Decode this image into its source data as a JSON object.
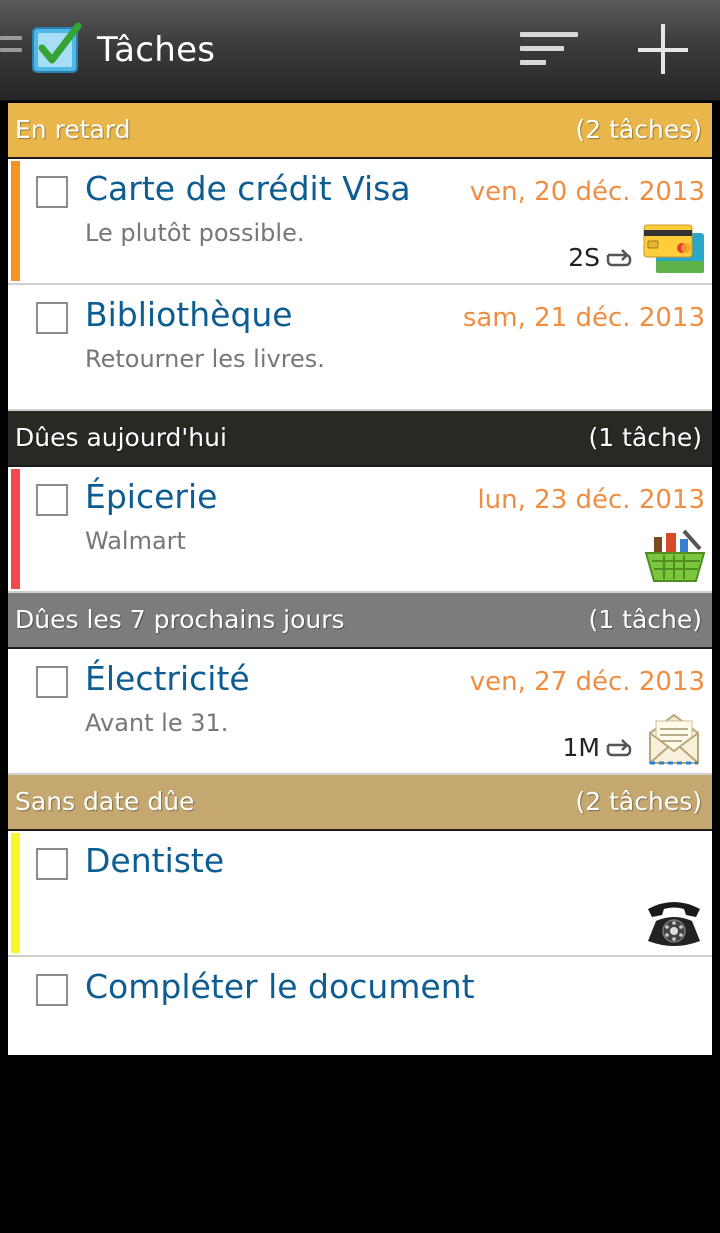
{
  "app": {
    "title": "Tâches"
  },
  "sections": [
    {
      "label": "En retard",
      "count": "(2 tâches)",
      "color": "#e8b64a",
      "tasks": [
        {
          "name": "Carte de crédit Visa",
          "date": "ven, 20 déc. 2013",
          "note": "Le plutôt possible.",
          "recurrence": "2S",
          "priority_color": "#f7931e",
          "icon": "credit-card-icon"
        },
        {
          "name": "Bibliothèque",
          "date": "sam, 21 déc. 2013",
          "note": "Retourner les livres."
        }
      ]
    },
    {
      "label": "Dûes aujourd'hui",
      "count": "(1 tâche)",
      "color": "#262a23",
      "tasks": [
        {
          "name": "Épicerie",
          "date": "lun, 23 déc. 2013",
          "note": "Walmart",
          "priority_color": "#f1494d",
          "icon": "grocery-basket-icon"
        }
      ]
    },
    {
      "label": "Dûes les 7 prochains jours",
      "count": "(1 tâche)",
      "color": "#7b7d7a",
      "tasks": [
        {
          "name": "Électricité",
          "date": "ven, 27 déc. 2013",
          "note": "Avant le 31.",
          "recurrence": "1M",
          "icon": "envelope-icon"
        }
      ]
    },
    {
      "label": "Sans date dûe",
      "count": "(2 tâches)",
      "color": "#c4a86f",
      "tasks": [
        {
          "name": "Dentiste",
          "priority_color": "#f7f72e",
          "icon": "telephone-icon"
        },
        {
          "name": "Compléter le document"
        }
      ]
    }
  ],
  "colors": {
    "date": "#f08d40",
    "task_name": "#0d5c92",
    "note": "#777777"
  }
}
